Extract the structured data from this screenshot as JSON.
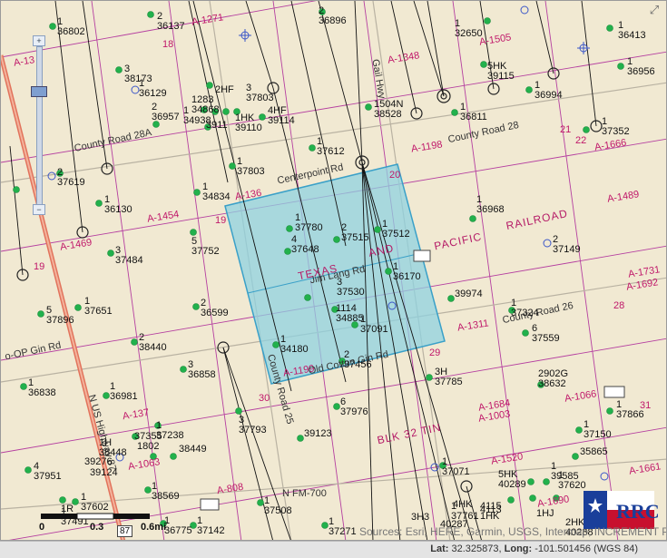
{
  "map": {
    "selected_area": {
      "labels": [
        "TEXAS",
        "AND",
        "PACIFIC",
        "RAILROAD"
      ]
    },
    "roads": [
      "Centerpoint Rd",
      "County Road 28A",
      "County Road 28",
      "County Road 26",
      "County Road 25",
      "Jim Lang Rd",
      "Old Cotton Gin Rd",
      "N FM-700",
      "N US Highway 87",
      "Gail Hwy",
      "o-OP Gin Rd"
    ],
    "abstracts": [
      "A-1271",
      "A-13",
      "A-1348",
      "A-1505",
      "A-1198",
      "A-1666",
      "A-136",
      "A-1454",
      "A-1469",
      "A-1489",
      "A-1731",
      "A-1692",
      "A-1311",
      "A-1199",
      "A-1003",
      "A-1684",
      "A-1520",
      "A-1661",
      "A-808",
      "A-137",
      "A-1063",
      "A-1690",
      "A-1066"
    ],
    "sections": [
      "18",
      "19",
      "20",
      "21",
      "22",
      "28",
      "29",
      "30",
      "31",
      "19"
    ],
    "railroad_text": "RAILROAD",
    "tp_text": "PACIFIC",
    "blk": "BLK 32 TIN",
    "wells": [
      [
        "1",
        "36802"
      ],
      [
        "2",
        "36137"
      ],
      [
        "2",
        "36896"
      ],
      [
        "1",
        "32650"
      ],
      [
        "1",
        "36413"
      ],
      [
        "3",
        "38173"
      ],
      [
        "1",
        "36129"
      ],
      [
        "1283",
        "34868"
      ],
      [
        "2HF",
        ""
      ],
      [
        "3",
        "37803"
      ],
      [
        "5HK",
        "39115"
      ],
      [
        "1",
        "36956"
      ],
      [
        "1504N",
        "38528"
      ],
      [
        "1",
        "36811"
      ],
      [
        "1",
        "36994"
      ],
      [
        "2",
        "36957"
      ],
      [
        "1",
        "34938"
      ],
      [
        "3911",
        ""
      ],
      [
        "1HK",
        "39110"
      ],
      [
        "4HF",
        "39114"
      ],
      [
        "1",
        "37612"
      ],
      [
        "1",
        "37352"
      ],
      [
        "1",
        "37803"
      ],
      [
        "2",
        "37619"
      ],
      [
        "1",
        "34834"
      ],
      [
        "1",
        "36130"
      ],
      [
        "1",
        "36968"
      ],
      [
        "1",
        "37780"
      ],
      [
        "2",
        "37515"
      ],
      [
        "1",
        "37512"
      ],
      [
        "4",
        "37648"
      ],
      [
        "5",
        "37752"
      ],
      [
        "3",
        "37484"
      ],
      [
        "2",
        "37149"
      ],
      [
        "1",
        "36170"
      ],
      [
        "3",
        "37530"
      ],
      [
        "39974",
        ""
      ],
      [
        "1",
        "37324"
      ],
      [
        "1114",
        "34885"
      ],
      [
        "1",
        "37091"
      ],
      [
        "6",
        "37559"
      ],
      [
        "1",
        "37651"
      ],
      [
        "5",
        "37896"
      ],
      [
        "2",
        "36599"
      ],
      [
        "1",
        "34180"
      ],
      [
        "2",
        "37456"
      ],
      [
        "3H",
        "37785"
      ],
      [
        "2902G",
        "38632"
      ],
      [
        "2",
        "38440"
      ],
      [
        "3",
        "36858"
      ],
      [
        "1",
        "36838"
      ],
      [
        "1",
        "36981"
      ],
      [
        "6",
        "37976"
      ],
      [
        "1",
        "37866"
      ],
      [
        "3",
        "37793"
      ],
      [
        "1",
        "37238"
      ],
      [
        "37355",
        ""
      ],
      [
        "1802",
        ""
      ],
      [
        "38449",
        ""
      ],
      [
        "1H",
        "38448"
      ],
      [
        "39276",
        ""
      ],
      [
        "39124",
        ""
      ],
      [
        "39123",
        ""
      ],
      [
        "1",
        "37150"
      ],
      [
        "4",
        "37951"
      ],
      [
        "1",
        "37602"
      ],
      [
        "1",
        "37491"
      ],
      [
        "1",
        "38569"
      ],
      [
        "1",
        "36775"
      ],
      [
        "1",
        "37142"
      ],
      [
        "1",
        "37508"
      ],
      [
        "1",
        "37271"
      ],
      [
        "1",
        "37071"
      ],
      [
        "1",
        "39585"
      ],
      [
        "35865",
        ""
      ],
      [
        "1",
        "37620"
      ],
      [
        "5HK",
        "40289"
      ],
      [
        "1",
        "37761"
      ],
      [
        "4113",
        ""
      ],
      [
        "4115",
        "1HK"
      ],
      [
        "4HK",
        ""
      ],
      [
        "3H3",
        ""
      ],
      [
        "1HJ",
        ""
      ],
      [
        "2HK",
        "40288"
      ],
      [
        "40287",
        ""
      ],
      [
        "2HB",
        ""
      ]
    ]
  },
  "scale": {
    "labels": [
      "0",
      "0.3",
      "0.6mi"
    ],
    "mark": "1R",
    "shield": "87"
  },
  "attribution": "Sources: Esri, HERE, Garmin, USGS, Intermap, INCREMENT P, NRCan",
  "status": {
    "lat_label": "Lat:",
    "lat": "32.325873",
    "long_label": "Long:",
    "long": "-101.501456",
    "datum": "(WGS 84)"
  },
  "logo_text": "RRC",
  "colors": {
    "selection_fill": "#8fd1e0",
    "selection_stroke": "#3aa0c8",
    "well_green": "#22b14c",
    "abstract_line": "#b53fa0",
    "highway": "#e2735c"
  }
}
